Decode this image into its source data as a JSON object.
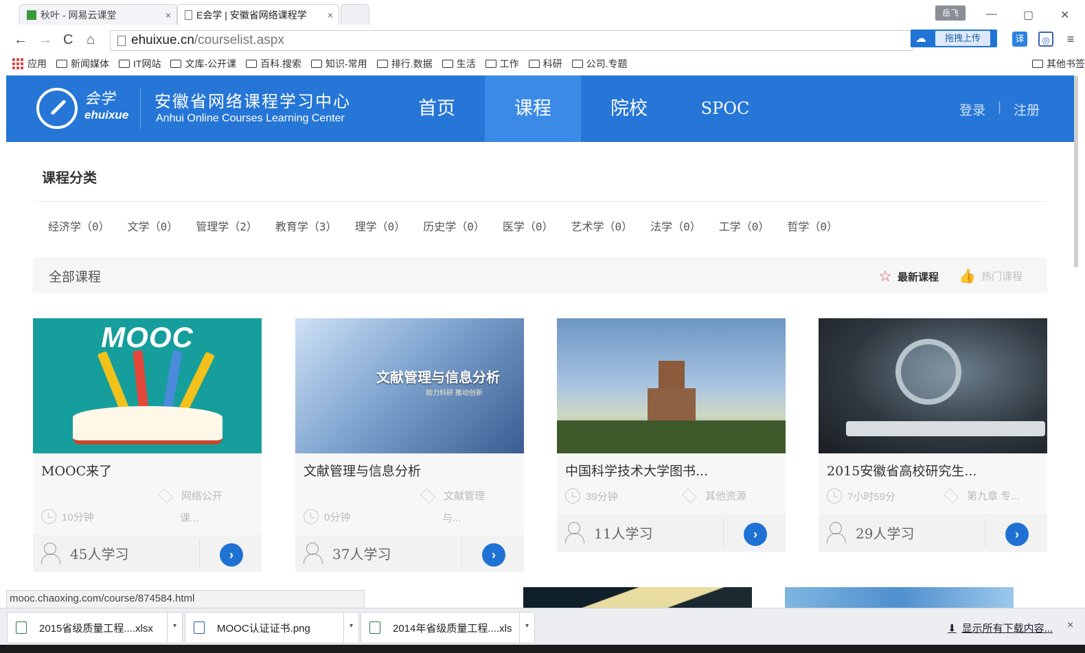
{
  "browser": {
    "tabs": [
      {
        "title": "秋叶 - 网易云课堂",
        "active": false
      },
      {
        "title": "E会学 | 安徽省网络课程学",
        "active": true
      }
    ],
    "user_badge": "岳飞",
    "url_host": "ehuixue.cn",
    "url_path": "/courselist.aspx",
    "upload_label": "拖拽上传",
    "translate_label": "译",
    "bookmarks": [
      "应用",
      "新闻媒体",
      "IT网站",
      "文库-公开课",
      "百科.搜索",
      "知识-常用",
      "排行.数据",
      "生活",
      "工作",
      "科研",
      "公司.专题"
    ],
    "other_bookmarks": "其他书签"
  },
  "site": {
    "logo_cn": "会学",
    "logo_en": "ehuixue",
    "title": "安徽省网络课程学习中心",
    "subtitle": "Anhui Online Courses Learning Center",
    "nav": [
      "首页",
      "课程",
      "院校",
      "SPOC"
    ],
    "active_nav": 1,
    "login": "登录",
    "register": "注册",
    "separator": "|",
    "accent": "#2576d6"
  },
  "categories": {
    "heading": "课程分类",
    "items": [
      "经济学（0）",
      "文学（0）",
      "管理学（2）",
      "教育学（3）",
      "理学（0）",
      "历史学（0）",
      "医学（0）",
      "艺术学（0）",
      "法学（0）",
      "工学（0）",
      "哲学（0）"
    ]
  },
  "filter": {
    "all_label": "全部课程",
    "newest_label": "最新课程",
    "hot_label": "热门课程"
  },
  "courses": [
    {
      "title": "MOOC来了",
      "thumb_word": "MOOC",
      "duration": "10分钟",
      "category": "网络公开",
      "category2": "课...",
      "learners": "45人学习"
    },
    {
      "title": "文献管理与信息分析",
      "thumb_text": "文献管理与信息分析",
      "thumb_sub": "助力科研  推动创新",
      "duration": "0分钟",
      "category": "文献管理",
      "category2": "与...",
      "learners": "37人学习"
    },
    {
      "title": "中国科学技术大学图书...",
      "duration": "39分钟",
      "category": "其他资源",
      "learners": "11人学习"
    },
    {
      "title": "2015安徽省高校研究生...",
      "duration": "7小时59分",
      "category": "第九章 专...",
      "learners": "29人学习"
    }
  ],
  "status_url": "mooc.chaoxing.com/course/874584.html",
  "downloads": [
    {
      "name": "2015省级质量工程....xlsx"
    },
    {
      "name": "MOOC认证证书.png"
    },
    {
      "name": "2014年省级质量工程....xls"
    }
  ],
  "show_all_downloads": "显示所有下载内容..."
}
